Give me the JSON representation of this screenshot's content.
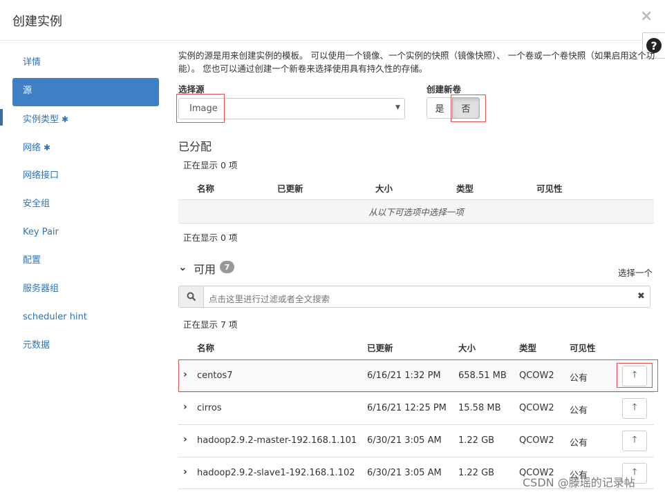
{
  "dialog": {
    "title": "创建实例",
    "close": "×",
    "help": "?"
  },
  "sidebar": {
    "items": [
      {
        "label": "详情",
        "required": false
      },
      {
        "label": "源",
        "required": false,
        "active": true
      },
      {
        "label": "实例类型",
        "required": true
      },
      {
        "label": "网络",
        "required": true
      },
      {
        "label": "网络接口",
        "required": false
      },
      {
        "label": "安全组",
        "required": false
      },
      {
        "label": "Key Pair",
        "required": false
      },
      {
        "label": "配置",
        "required": false
      },
      {
        "label": "服务器组",
        "required": false
      },
      {
        "label": "scheduler hint",
        "required": false
      },
      {
        "label": "元数据",
        "required": false
      }
    ],
    "required_mark": "✱"
  },
  "source": {
    "description": "实例的源是用来创建实例的模板。 可以使用一个镜像、一个实例的快照（镜像快照）、 一个卷或一个卷快照（如果启用这个功能）。 您也可以通过创建一个新卷来选择使用具有持久性的存储。",
    "select_label": "选择源",
    "select_value": "Image",
    "new_volume_label": "创建新卷",
    "yes": "是",
    "no": "否"
  },
  "allocated": {
    "title": "已分配",
    "count_top": "正在显示 0 项",
    "columns": [
      "名称",
      "已更新",
      "大小",
      "类型",
      "可见性"
    ],
    "empty": "从以下可选项中选择一项",
    "count_bottom": "正在显示 0 项"
  },
  "available": {
    "title": "可用",
    "badge": "7",
    "select_one": "选择一个",
    "search_placeholder": "点击这里进行过滤或者全文搜索",
    "count": "正在显示 7 项",
    "columns": [
      "名称",
      "已更新",
      "大小",
      "类型",
      "可见性"
    ],
    "rows": [
      {
        "name": "centos7",
        "updated": "6/16/21 1:32 PM",
        "size": "658.51 MB",
        "type": "QCOW2",
        "visibility": "公有"
      },
      {
        "name": "cirros",
        "updated": "6/16/21 12:25 PM",
        "size": "15.58 MB",
        "type": "QCOW2",
        "visibility": "公有"
      },
      {
        "name": "hadoop2.9.2-master-192.168.1.101",
        "updated": "6/30/21 3:05 AM",
        "size": "1.22 GB",
        "type": "QCOW2",
        "visibility": "公有"
      },
      {
        "name": "hadoop2.9.2-slave1-192.168.1.102",
        "updated": "6/30/21 3:05 AM",
        "size": "1.22 GB",
        "type": "QCOW2",
        "visibility": "公有"
      }
    ]
  },
  "watermark": "CSDN @滕瑶的记录帖",
  "colors": {
    "accent": "#3f7fc5",
    "link": "#2f73b5",
    "highlight": "#d9534f"
  }
}
